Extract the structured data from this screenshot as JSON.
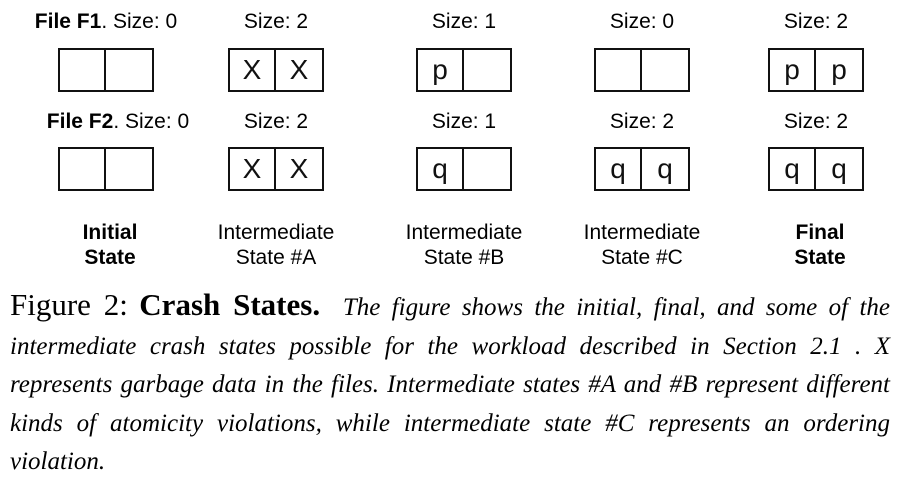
{
  "files": [
    {
      "name": "File F1",
      "states": [
        {
          "size_label": "Size: 0",
          "blocks": [
            "",
            ""
          ]
        },
        {
          "size_label": "Size: 2",
          "blocks": [
            "X",
            "X"
          ]
        },
        {
          "size_label": "Size: 1",
          "blocks": [
            "p",
            ""
          ]
        },
        {
          "size_label": "Size: 0",
          "blocks": [
            "",
            ""
          ]
        },
        {
          "size_label": "Size: 2",
          "blocks": [
            "p",
            "p"
          ]
        }
      ]
    },
    {
      "name": "File F2",
      "states": [
        {
          "size_label": "Size: 0",
          "blocks": [
            "",
            ""
          ]
        },
        {
          "size_label": "Size: 2",
          "blocks": [
            "X",
            "X"
          ]
        },
        {
          "size_label": "Size: 1",
          "blocks": [
            "q",
            ""
          ]
        },
        {
          "size_label": "Size: 2",
          "blocks": [
            "q",
            "q"
          ]
        },
        {
          "size_label": "Size: 2",
          "blocks": [
            "q",
            "q"
          ]
        }
      ]
    }
  ],
  "state_labels": [
    {
      "line1": "Initial",
      "line2": "State"
    },
    {
      "line1": "Intermediate",
      "line2": "State #A"
    },
    {
      "line1": "Intermediate",
      "line2": "State #B"
    },
    {
      "line1": "Intermediate",
      "line2": "State #C"
    },
    {
      "line1": "Final",
      "line2": "State"
    }
  ],
  "caption": {
    "figure_number": "Figure 2:",
    "title": "Crash States.",
    "body": "The figure shows the initial, final, and some of the intermediate crash states possible for the workload described in Section 2.1 . X represents garbage data in the files. Intermediate states #A and #B represent different kinds of atomicity violations, while intermediate state #C represents an ordering violation."
  }
}
